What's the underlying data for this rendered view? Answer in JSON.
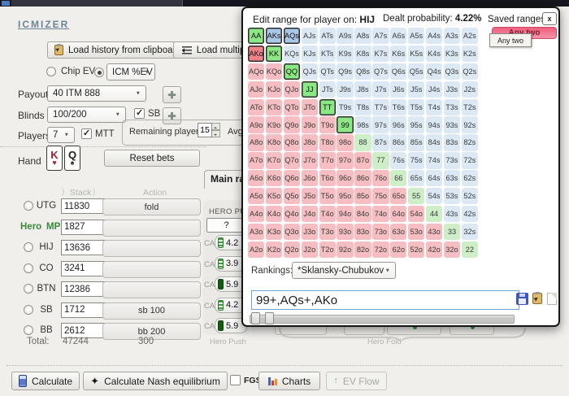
{
  "window": {
    "logo": "ICMIZER"
  },
  "toolbar": {
    "load_history": "Load history from clipboard",
    "load_multiple": "Load multiple",
    "chip_ev": "Chip EV",
    "icm_ev": "ICM %EV"
  },
  "settings": {
    "payout_label": "Payout",
    "payout_value": "40 ITM 888",
    "blinds_label": "Blinds",
    "blinds_value": "100/200",
    "sb_label": "SB",
    "players_label": "Players",
    "players_value": "7",
    "mtt_label": "MTT",
    "remaining_label": "Remaining players",
    "remaining_value": "15",
    "avg_label": "Avg."
  },
  "hand": {
    "label": "Hand",
    "cards": [
      {
        "rank": "K",
        "suit": "♥",
        "color": "red"
      },
      {
        "rank": "Q",
        "suit": "♠",
        "color": "black"
      }
    ],
    "reset_label": "Reset bets"
  },
  "table": {
    "stack_header": "Stack",
    "action_header": "Action",
    "hero_label": "Hero",
    "rows": [
      {
        "pos": "UTG",
        "stack": "11830",
        "action": "fold",
        "hero": false
      },
      {
        "pos": "MP",
        "stack": "1827",
        "action": "",
        "hero": true
      },
      {
        "pos": "HIJ",
        "stack": "13636",
        "action": "",
        "hero": false
      },
      {
        "pos": "CO",
        "stack": "3241",
        "action": "",
        "hero": false
      },
      {
        "pos": "BTN",
        "stack": "12386",
        "action": "",
        "hero": false
      },
      {
        "pos": "SB",
        "stack": "1712",
        "action": "sb 100",
        "hero": false
      },
      {
        "pos": "BB",
        "stack": "2612",
        "action": "bb 200",
        "hero": false
      }
    ],
    "total_label": "Total:",
    "total_stack": "47244",
    "total_action": "300"
  },
  "push_panel": {
    "tab_label": "Main range",
    "header": "HERO PUSH",
    "question_label": "?",
    "ca_label": "CA",
    "rows": [
      {
        "value": "4.2",
        "battery": "segmented"
      },
      {
        "value": "3.9",
        "battery": "segmented"
      },
      {
        "value": "5.9",
        "battery": "full"
      },
      {
        "value": "4.2",
        "battery": "segmented"
      },
      {
        "value": "5.9",
        "battery": "full"
      }
    ],
    "hero_push_label": "Hero Push",
    "hero_fold_label": "Hero Fold"
  },
  "footer": {
    "calculate": "Calculate",
    "nash": "Calculate Nash equilibrium",
    "fgs": "FGS",
    "charts": "Charts",
    "ev_flow": "EV Flow"
  },
  "overlay": {
    "title_prefix": "Edit range for player on:",
    "player": "HIJ",
    "dealt_label": "Dealt probability:",
    "dealt_value": "4.22%",
    "saved_ranges_label": "Saved ranges",
    "close_label": "x",
    "saved_range": {
      "label": "Any two",
      "tooltip": "Any two"
    },
    "rankings_label": "Rankings:",
    "rankings_value": "*Sklansky-Chubukov",
    "range_input": "99+,AQs+,AKo",
    "colors": {
      "pair": "#cdeec6",
      "suited": "#dce9f5",
      "offsuit": "#f6bec2",
      "pair_selected": "#8ce884",
      "suited_selected": "#a9c7e9",
      "offsuit_selected": "#ee838a",
      "selected_border": "#2d2d2d",
      "badge": "#f26b86"
    },
    "grid": {
      "selected": [
        "AA",
        "AKs",
        "AQs",
        "AKo",
        "KK",
        "QQ",
        "JJ",
        "TT",
        "99"
      ],
      "rows": [
        [
          "AA",
          "AKs",
          "AQs",
          "AJs",
          "ATs",
          "A9s",
          "A8s",
          "A7s",
          "A6s",
          "A5s",
          "A4s",
          "A3s",
          "A2s"
        ],
        [
          "AKo",
          "KK",
          "KQs",
          "KJs",
          "KTs",
          "K9s",
          "K8s",
          "K7s",
          "K6s",
          "K5s",
          "K4s",
          "K3s",
          "K2s"
        ],
        [
          "AQo",
          "KQo",
          "QQ",
          "QJs",
          "QTs",
          "Q9s",
          "Q8s",
          "Q7s",
          "Q6s",
          "Q5s",
          "Q4s",
          "Q3s",
          "Q2s"
        ],
        [
          "AJo",
          "KJo",
          "QJo",
          "JJ",
          "JTs",
          "J9s",
          "J8s",
          "J7s",
          "J6s",
          "J5s",
          "J4s",
          "J3s",
          "J2s"
        ],
        [
          "ATo",
          "KTo",
          "QTo",
          "JTo",
          "TT",
          "T9s",
          "T8s",
          "T7s",
          "T6s",
          "T5s",
          "T4s",
          "T3s",
          "T2s"
        ],
        [
          "A9o",
          "K9o",
          "Q9o",
          "J9o",
          "T9o",
          "99",
          "98s",
          "97s",
          "96s",
          "95s",
          "94s",
          "93s",
          "92s"
        ],
        [
          "A8o",
          "K8o",
          "Q8o",
          "J8o",
          "T8o",
          "98o",
          "88",
          "87s",
          "86s",
          "85s",
          "84s",
          "83s",
          "82s"
        ],
        [
          "A7o",
          "K7o",
          "Q7o",
          "J7o",
          "T7o",
          "97o",
          "87o",
          "77",
          "76s",
          "75s",
          "74s",
          "73s",
          "72s"
        ],
        [
          "A6o",
          "K6o",
          "Q6o",
          "J6o",
          "T6o",
          "96o",
          "86o",
          "76o",
          "66",
          "65s",
          "64s",
          "63s",
          "62s"
        ],
        [
          "A5o",
          "K5o",
          "Q5o",
          "J5o",
          "T5o",
          "95o",
          "85o",
          "75o",
          "65o",
          "55",
          "54s",
          "53s",
          "52s"
        ],
        [
          "A4o",
          "K4o",
          "Q4o",
          "J4o",
          "T4o",
          "94o",
          "84o",
          "74o",
          "64o",
          "54o",
          "44",
          "43s",
          "42s"
        ],
        [
          "A3o",
          "K3o",
          "Q3o",
          "J3o",
          "T3o",
          "93o",
          "83o",
          "73o",
          "63o",
          "53o",
          "43o",
          "33",
          "32s"
        ],
        [
          "A2o",
          "K2o",
          "Q2o",
          "J2o",
          "T2o",
          "92o",
          "82o",
          "72o",
          "62o",
          "52o",
          "42o",
          "32o",
          "22"
        ]
      ]
    }
  }
}
